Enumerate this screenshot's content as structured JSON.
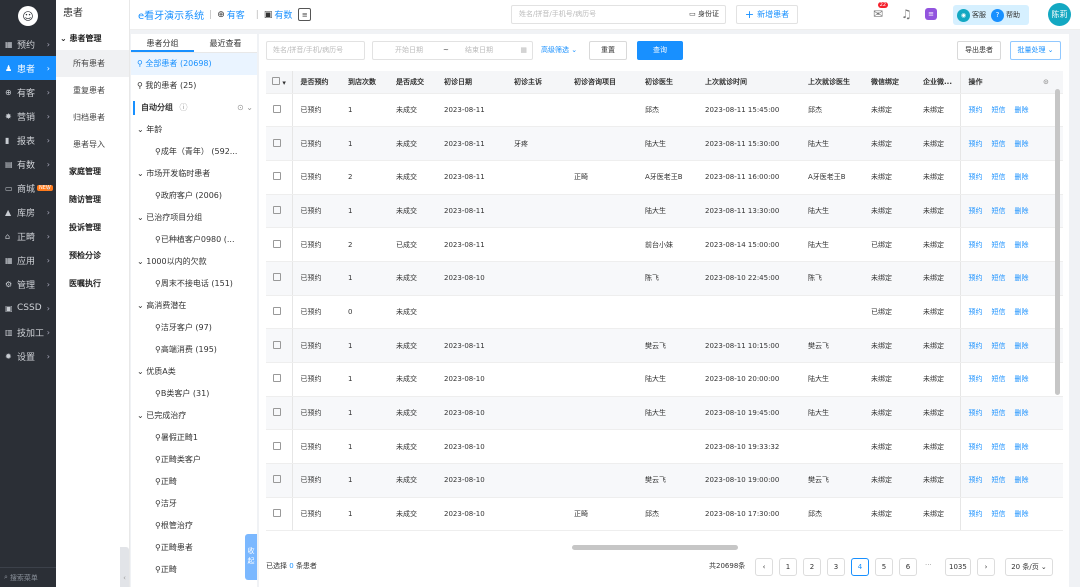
{
  "left_nav": {
    "items": [
      {
        "label": "预约",
        "icon": "calendar-icon",
        "active": false
      },
      {
        "label": "患者",
        "icon": "user-icon",
        "active": true
      },
      {
        "label": "有客",
        "icon": "globe-icon",
        "active": false
      },
      {
        "label": "营销",
        "icon": "marketing-icon",
        "active": false
      },
      {
        "label": "报表",
        "icon": "chart-icon",
        "active": false
      },
      {
        "label": "有数",
        "icon": "data-icon",
        "active": false
      },
      {
        "label": "商城",
        "icon": "shop-icon",
        "active": false,
        "badge": "NEW"
      },
      {
        "label": "库房",
        "icon": "warehouse-icon",
        "active": false
      },
      {
        "label": "正畸",
        "icon": "ortho-icon",
        "active": false
      },
      {
        "label": "应用",
        "icon": "app-icon",
        "active": false
      },
      {
        "label": "管理",
        "icon": "manage-icon",
        "active": false
      },
      {
        "label": "CSSD",
        "icon": "cssd-icon",
        "active": false
      },
      {
        "label": "技加工",
        "icon": "lab-icon",
        "active": false
      },
      {
        "label": "设置",
        "icon": "gear-icon",
        "active": false
      }
    ],
    "search_menu": "搜索菜单"
  },
  "second_nav": {
    "title": "患者",
    "group_title": "患者管理",
    "sub_items": [
      "所有患者",
      "重复患者",
      "归档患者",
      "患者导入"
    ],
    "groups": [
      "家庭管理",
      "随访管理",
      "投诉管理",
      "预检分诊",
      "医嘱执行"
    ]
  },
  "topbar": {
    "system_name": "e看牙演示系统",
    "tab1": "有客",
    "tab2": "有数",
    "search_placeholder": "姓名/拼音/手机号/病历号",
    "id_card": "身份证",
    "add_patient": "新增患者",
    "msg_count": "22",
    "support": "客服",
    "help": "帮助",
    "user": "陈莉"
  },
  "group_panel": {
    "tabs": [
      "患者分组",
      "最近查看"
    ],
    "all_patients": "全部患者 (20698)",
    "my_patients": "我的患者 (25)",
    "auto_group": "自动分组",
    "tree": [
      {
        "level": 0,
        "label": "年龄"
      },
      {
        "level": 1,
        "label": "成年（青年） (592..."
      },
      {
        "level": 0,
        "label": "市场开发临时患者"
      },
      {
        "level": 1,
        "label": "政府客户 (2006)"
      },
      {
        "level": 0,
        "label": "已治疗项目分组"
      },
      {
        "level": 1,
        "label": "已种植客户0980 (..."
      },
      {
        "level": 0,
        "label": "1000以内的欠款"
      },
      {
        "level": 1,
        "label": "周末不接电话 (151)"
      },
      {
        "level": 0,
        "label": "高消费潜在"
      },
      {
        "level": 1,
        "label": "洁牙客户 (97)"
      },
      {
        "level": 1,
        "label": "高端消费 (195)"
      },
      {
        "level": 0,
        "label": "优质A类"
      },
      {
        "level": 1,
        "label": "B类客户 (31)"
      },
      {
        "level": 0,
        "label": "已完成治疗"
      },
      {
        "level": 1,
        "label": "暑假正畸1"
      },
      {
        "level": 1,
        "label": "正畸类客户"
      },
      {
        "level": 1,
        "label": "正畸"
      },
      {
        "level": 1,
        "label": "洁牙"
      },
      {
        "level": 1,
        "label": "根管治疗"
      },
      {
        "level": 1,
        "label": "正畸患者"
      },
      {
        "level": 1,
        "label": "正畸"
      }
    ],
    "collapse": "收起"
  },
  "filters": {
    "search_placeholder": "姓名/拼音/手机/病历号",
    "start_date": "开始日期",
    "tilde": "~",
    "end_date": "结束日期",
    "advanced": "高级筛选",
    "reset": "重置",
    "query": "查询",
    "export": "导出患者",
    "batch": "批量处理"
  },
  "table": {
    "columns": [
      "是否预约",
      "到店次数",
      "是否成交",
      "初诊日期",
      "初诊主诉",
      "初诊咨询项目",
      "初诊医生",
      "上次就诊时间",
      "上次就诊医生",
      "微信绑定",
      "企业微...",
      "操作"
    ],
    "ops": [
      "预约",
      "短信",
      "删除"
    ],
    "rows": [
      [
        "已预约",
        "1",
        "未成交",
        "2023-08-11",
        "",
        "",
        "邱杰",
        "2023-08-11 15:45:00",
        "邱杰",
        "未绑定",
        "未绑定"
      ],
      [
        "已预约",
        "1",
        "未成交",
        "2023-08-11",
        "牙疼",
        "",
        "陆大生",
        "2023-08-11 15:30:00",
        "陆大生",
        "未绑定",
        "未绑定"
      ],
      [
        "已预约",
        "2",
        "未成交",
        "2023-08-11",
        "",
        "正畸",
        "A牙医老王B",
        "2023-08-11 16:00:00",
        "A牙医老王B",
        "未绑定",
        "未绑定"
      ],
      [
        "已预约",
        "1",
        "未成交",
        "2023-08-11",
        "",
        "",
        "陆大生",
        "2023-08-11 13:30:00",
        "陆大生",
        "未绑定",
        "未绑定"
      ],
      [
        "已预约",
        "2",
        "已成交",
        "2023-08-11",
        "",
        "",
        "前台小妹",
        "2023-08-14 15:00:00",
        "陆大生",
        "已绑定",
        "未绑定"
      ],
      [
        "已预约",
        "1",
        "未成交",
        "2023-08-10",
        "",
        "",
        "陈飞",
        "2023-08-10 22:45:00",
        "陈飞",
        "未绑定",
        "未绑定"
      ],
      [
        "已预约",
        "0",
        "未成交",
        "",
        "",
        "",
        "",
        "",
        "",
        "已绑定",
        "未绑定"
      ],
      [
        "已预约",
        "1",
        "未成交",
        "2023-08-11",
        "",
        "",
        "樊云飞",
        "2023-08-11 10:15:00",
        "樊云飞",
        "未绑定",
        "未绑定"
      ],
      [
        "已预约",
        "1",
        "未成交",
        "2023-08-10",
        "",
        "",
        "陆大生",
        "2023-08-10 20:00:00",
        "陆大生",
        "未绑定",
        "未绑定"
      ],
      [
        "已预约",
        "1",
        "未成交",
        "2023-08-10",
        "",
        "",
        "陆大生",
        "2023-08-10 19:45:00",
        "陆大生",
        "未绑定",
        "未绑定"
      ],
      [
        "已预约",
        "1",
        "未成交",
        "2023-08-10",
        "",
        "",
        "",
        "2023-08-10 19:33:32",
        "",
        "未绑定",
        "未绑定"
      ],
      [
        "已预约",
        "1",
        "未成交",
        "2023-08-10",
        "",
        "",
        "樊云飞",
        "2023-08-10 19:00:00",
        "樊云飞",
        "未绑定",
        "未绑定"
      ],
      [
        "已预约",
        "1",
        "未成交",
        "2023-08-10",
        "",
        "正畸",
        "邱杰",
        "2023-08-10 17:30:00",
        "邱杰",
        "未绑定",
        "未绑定"
      ]
    ]
  },
  "footer": {
    "selected_prefix": "已选择",
    "selected_count": "0",
    "selected_suffix": "条患者",
    "total": "共20698条",
    "pages": [
      "1",
      "2",
      "3",
      "4",
      "5",
      "6"
    ],
    "ellipsis": "···",
    "last_page": "1035",
    "current_page": "4",
    "page_size": "20 条/页"
  },
  "colors": {
    "accent": "#1890ff",
    "nav_bg": "#2b2f36",
    "avatar": "#13a8c2"
  }
}
